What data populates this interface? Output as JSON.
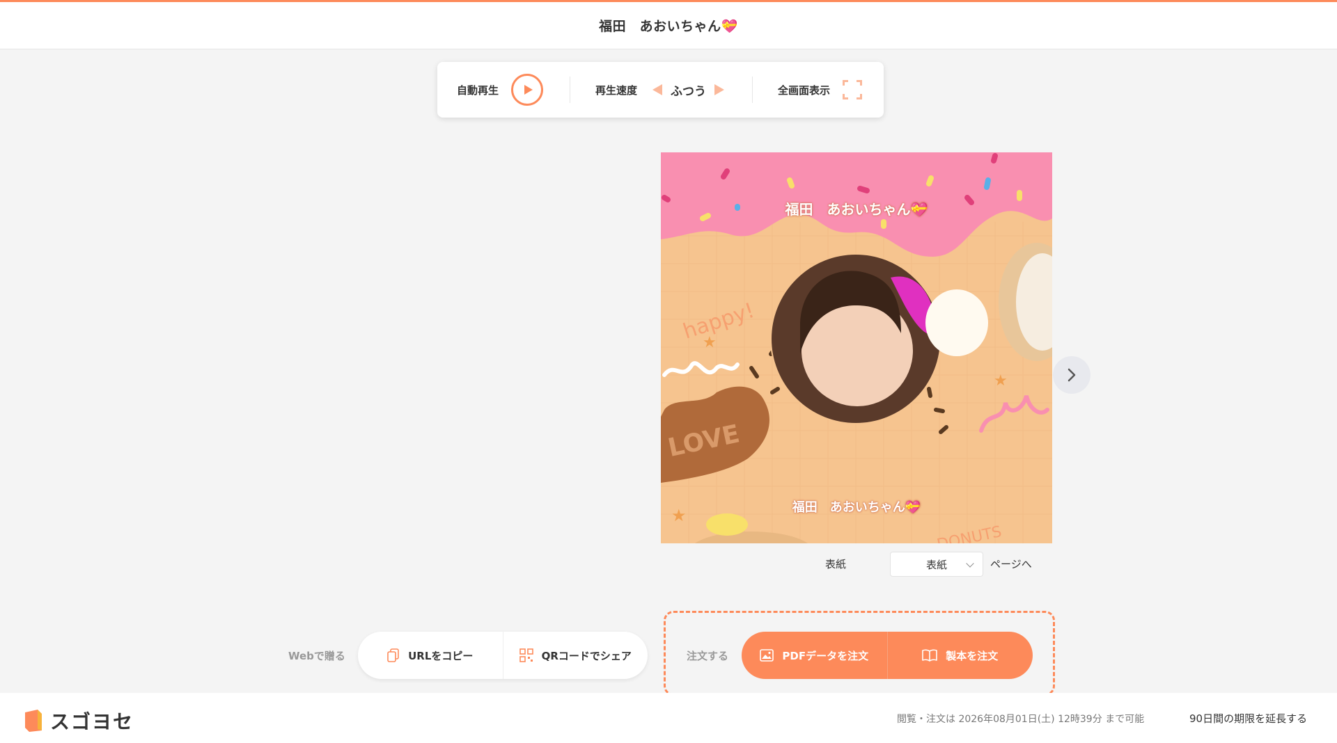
{
  "header": {
    "title": "福田　あおいちゃん💝"
  },
  "controls": {
    "autoplay_label": "自動再生",
    "speed_label": "再生速度",
    "speed_value": "ふつう",
    "fullscreen_label": "全画面表示"
  },
  "cover": {
    "title_top": "福田　あおいちゃん💝",
    "title_bottom": "福田　あおいちゃん💝",
    "deco_happy": "happy!",
    "deco_love": "LOVE",
    "deco_donuts": "DONUTS"
  },
  "page_nav": {
    "current_label": "表紙",
    "select_value": "表紙",
    "go_label": "ページへ"
  },
  "share": {
    "label": "Webで贈る",
    "copy_url": "URLをコピー",
    "qr_share": "QRコードでシェア"
  },
  "order": {
    "label": "注文する",
    "pdf": "PDFデータを注文",
    "book": "製本を注文"
  },
  "footer": {
    "logo_text": "スゴヨセ",
    "deadline": "閲覧・注文は 2026年08月01日(土) 12時39分 まで可能",
    "extend": "90日間の期限を延長する"
  },
  "colors": {
    "accent": "#fd8a5a",
    "frosting": "#f98fb0",
    "dough": "#f6c48f"
  },
  "icons": [
    "play-icon",
    "arrow-left-icon",
    "arrow-right-icon",
    "fullscreen-icon",
    "chevron-right-icon",
    "chevron-down-icon",
    "copy-icon",
    "qr-icon",
    "image-icon",
    "book-icon",
    "logo-icon"
  ]
}
